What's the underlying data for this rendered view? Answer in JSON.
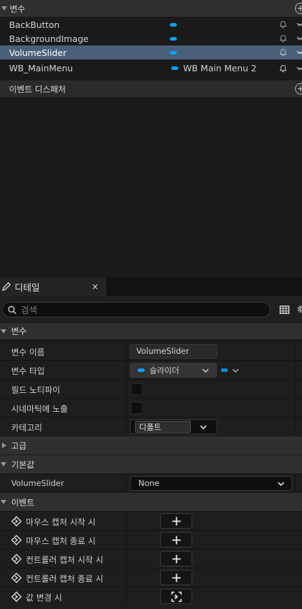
{
  "variables_section": {
    "title": "변수",
    "add_label": "+",
    "items": [
      {
        "name": "BackButton",
        "type_label": ""
      },
      {
        "name": "BackgroundImage",
        "type_label": ""
      },
      {
        "name": "VolumeSlider",
        "type_label": "",
        "selected": true
      },
      {
        "name": "WB_MainMenu",
        "type_label": "WB Main Menu 2"
      }
    ]
  },
  "dispatchers_section": {
    "title": "이벤트 디스패처",
    "add_label": "+"
  },
  "details": {
    "tab_label": "디테일",
    "close_label": "×",
    "search_placeholder": "검색",
    "variable_category": {
      "title": "변수",
      "rows": {
        "name_label": "변수 이름",
        "name_value": "VolumeSlider",
        "type_label": "변수 타입",
        "type_value": "슬라이더",
        "field_notify_label": "필드 노티파이",
        "cinematic_label": "시네마틱에 노출",
        "category_label": "카테고리",
        "category_value": "디폴트"
      }
    },
    "advanced_category": {
      "title": "고급"
    },
    "default_category": {
      "title": "기본값",
      "row_label": "VolumeSlider",
      "row_value": "None"
    },
    "events_category": {
      "title": "이벤트",
      "items": [
        {
          "label": "마우스 캡처 시작 시",
          "button": "plus"
        },
        {
          "label": "마우스 캡처 종료 시",
          "button": "plus"
        },
        {
          "label": "컨트롤러 캡처 시작 시",
          "button": "plus"
        },
        {
          "label": "컨트롤러 캡처 종료 시",
          "button": "plus"
        },
        {
          "label": "값 변경 시",
          "button": "bind-focus"
        }
      ]
    }
  },
  "colors": {
    "accent_pill": "#0aa2ff",
    "selected_row": "#4a607a",
    "panel_bg": "#1a1a1a"
  }
}
